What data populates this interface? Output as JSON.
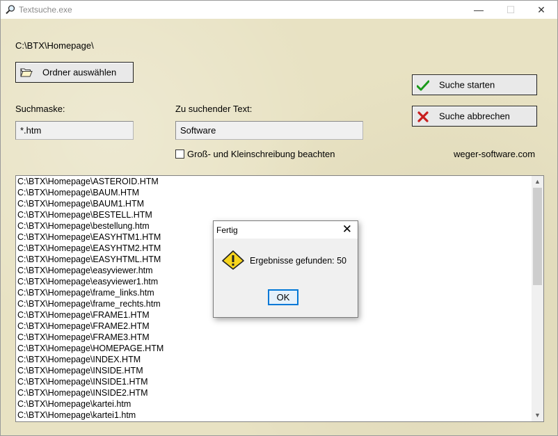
{
  "window": {
    "title": "Textsuche.exe",
    "min_glyph": "—",
    "max_glyph": "☐",
    "close_glyph": "✕"
  },
  "current_path": "C:\\BTX\\Homepage\\",
  "buttons": {
    "select_folder": "Ordner auswählen",
    "start_search": "Suche starten",
    "abort_search": "Suche abbrechen"
  },
  "search_mask": {
    "label": "Suchmaske:",
    "value": "*.htm"
  },
  "search_text": {
    "label": "Zu suchender Text:",
    "value": "Software"
  },
  "case_sensitive": {
    "label": "Groß- und Kleinschreibung beachten",
    "checked": false
  },
  "website": "weger-software.com",
  "results": [
    "C:\\BTX\\Homepage\\ASTEROID.HTM",
    "C:\\BTX\\Homepage\\BAUM.HTM",
    "C:\\BTX\\Homepage\\BAUM1.HTM",
    "C:\\BTX\\Homepage\\BESTELL.HTM",
    "C:\\BTX\\Homepage\\bestellung.htm",
    "C:\\BTX\\Homepage\\EASYHTM1.HTM",
    "C:\\BTX\\Homepage\\EASYHTM2.HTM",
    "C:\\BTX\\Homepage\\EASYHTML.HTM",
    "C:\\BTX\\Homepage\\easyviewer.htm",
    "C:\\BTX\\Homepage\\easyviewer1.htm",
    "C:\\BTX\\Homepage\\frame_links.htm",
    "C:\\BTX\\Homepage\\frame_rechts.htm",
    "C:\\BTX\\Homepage\\FRAME1.HTM",
    "C:\\BTX\\Homepage\\FRAME2.HTM",
    "C:\\BTX\\Homepage\\FRAME3.HTM",
    "C:\\BTX\\Homepage\\HOMEPAGE.HTM",
    "C:\\BTX\\Homepage\\INDEX.HTM",
    "C:\\BTX\\Homepage\\INSIDE.HTM",
    "C:\\BTX\\Homepage\\INSIDE1.HTM",
    "C:\\BTX\\Homepage\\INSIDE2.HTM",
    "C:\\BTX\\Homepage\\kartei.htm",
    "C:\\BTX\\Homepage\\kartei1.htm"
  ],
  "dialog": {
    "title": "Fertig",
    "message": "Ergebnisse gefunden: 50",
    "ok_label": "OK",
    "close_glyph": "✕",
    "icon": "warning-icon"
  },
  "scrollbar": {
    "up_glyph": "▲",
    "down_glyph": "▼"
  },
  "colors": {
    "background": "#e8e2c3",
    "check_green": "#1a9a1a",
    "cross_red": "#c81e1e",
    "ok_focus": "#0078d7",
    "warning_yellow": "#f7d51d"
  }
}
